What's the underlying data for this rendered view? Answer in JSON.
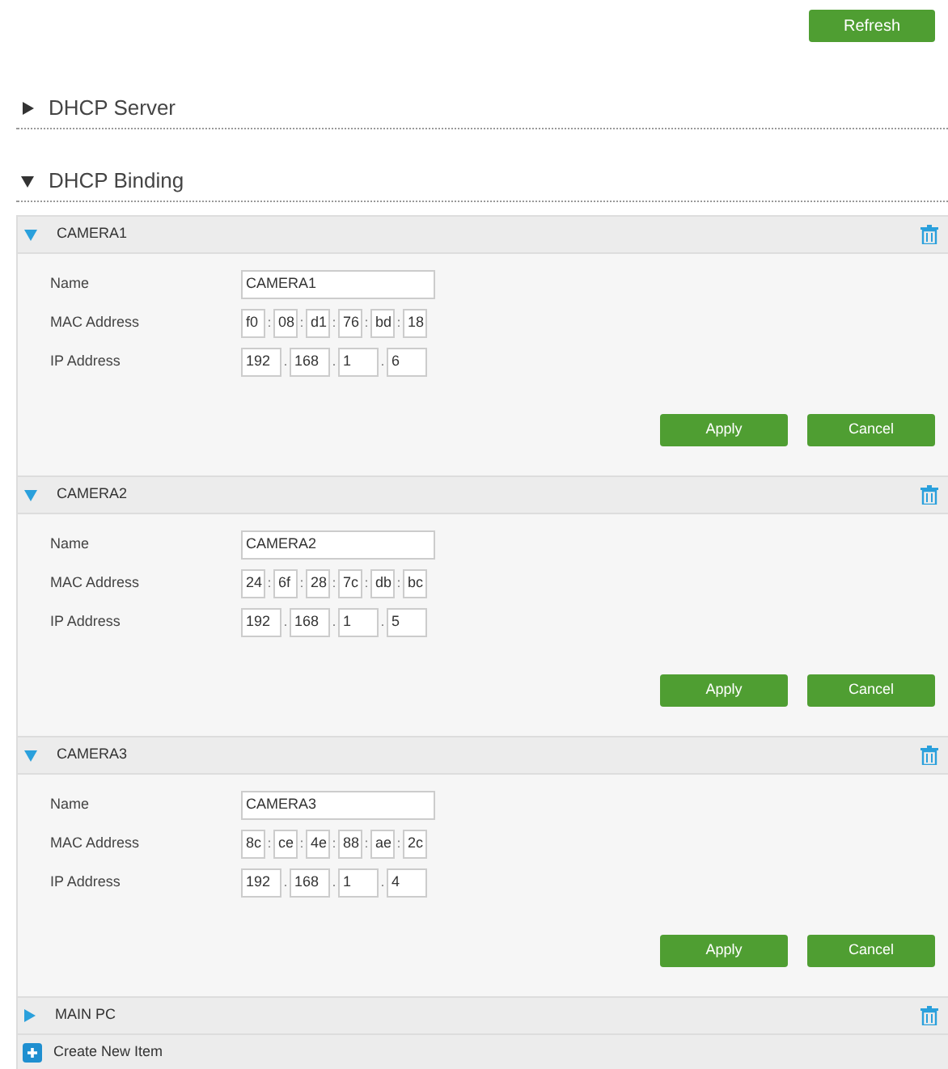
{
  "refresh_button": "Refresh",
  "sections": [
    {
      "title": "DHCP Server",
      "expanded": false
    },
    {
      "title": "DHCP Binding",
      "expanded": true
    }
  ],
  "bindings": [
    {
      "name": "CAMERA1",
      "expanded": true,
      "fields": {
        "name_label": "Name",
        "name_value": "CAMERA1",
        "mac_label": "MAC Address",
        "mac": [
          "f0",
          "08",
          "d1",
          "76",
          "bd",
          "18"
        ],
        "mac_sep": ":",
        "ip_label": "IP Address",
        "ip": [
          "192",
          "168",
          "1",
          "6"
        ],
        "ip_sep": "."
      },
      "buttons": [
        "Apply",
        "Cancel"
      ]
    },
    {
      "name": "CAMERA2",
      "expanded": true,
      "fields": {
        "name_label": "Name",
        "name_value": "CAMERA2",
        "mac_label": "MAC Address",
        "mac": [
          "24",
          "6f",
          "28",
          "7c",
          "db",
          "bc"
        ],
        "mac_sep": ":",
        "ip_label": "IP Address",
        "ip": [
          "192",
          "168",
          "1",
          "5"
        ],
        "ip_sep": "."
      },
      "buttons": [
        "Apply",
        "Cancel"
      ]
    },
    {
      "name": "CAMERA3",
      "expanded": true,
      "fields": {
        "name_label": "Name",
        "name_value": "CAMERA3",
        "mac_label": "MAC Address",
        "mac": [
          "8c",
          "ce",
          "4e",
          "88",
          "ae",
          "2c"
        ],
        "mac_sep": ":",
        "ip_label": "IP Address",
        "ip": [
          "192",
          "168",
          "1",
          "4"
        ],
        "ip_sep": "."
      },
      "buttons": [
        "Apply",
        "Cancel"
      ]
    },
    {
      "name": "MAIN PC",
      "expanded": false
    }
  ],
  "create_item": "Create New Item"
}
